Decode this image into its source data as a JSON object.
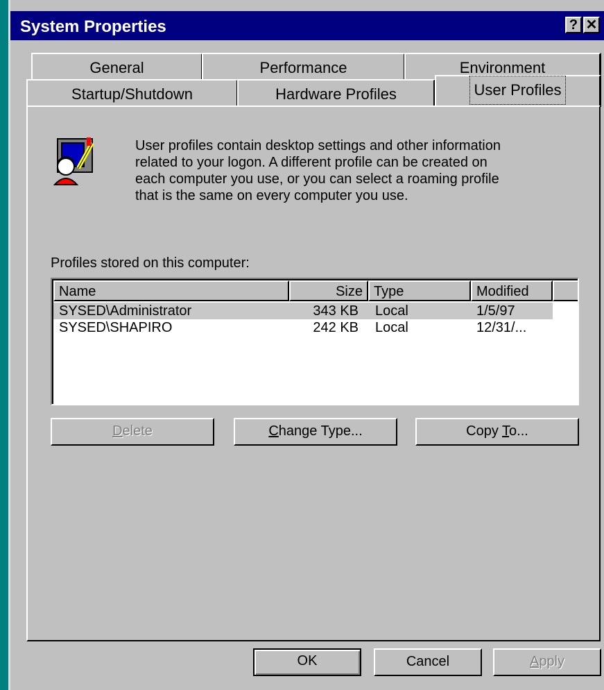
{
  "window": {
    "title": "System Properties",
    "help_label": "?",
    "close_label": "✕"
  },
  "tabs_row1": [
    "General",
    "Performance",
    "Environment"
  ],
  "tabs_row2": [
    "Startup/Shutdown",
    "Hardware Profiles",
    "User Profiles"
  ],
  "active_tab": "User Profiles",
  "description": [
    "User profiles contain desktop settings and other information",
    "related to your logon.  A different profile can be created on",
    "each computer you use, or you can select a roaming profile",
    "that is the same on every computer you use."
  ],
  "profiles_label": "Profiles stored on this computer:",
  "columns": [
    "Name",
    "Size",
    "Type",
    "Modified"
  ],
  "profiles": [
    {
      "name": "SYSED\\Administrator",
      "size": "343 KB",
      "type": "Local",
      "modified": "1/5/97",
      "selected": true
    },
    {
      "name": "SYSED\\SHAPIRO",
      "size": "242 KB",
      "type": "Local",
      "modified": "12/31/...",
      "selected": false
    }
  ],
  "buttons": {
    "delete_pre": "",
    "delete_key": "D",
    "delete_post": "elete",
    "change_pre": "",
    "change_key": "C",
    "change_post": "hange Type...",
    "copy_pre": "Copy ",
    "copy_key": "T",
    "copy_post": "o...",
    "ok": "OK",
    "cancel": "Cancel",
    "apply_pre": "",
    "apply_key": "A",
    "apply_post": "pply"
  },
  "colors": {
    "titlebar": "#000080",
    "face": "#c0c0c0",
    "desktop": "#008080"
  },
  "icons": {
    "profile_icon": "user-profile-icon"
  }
}
